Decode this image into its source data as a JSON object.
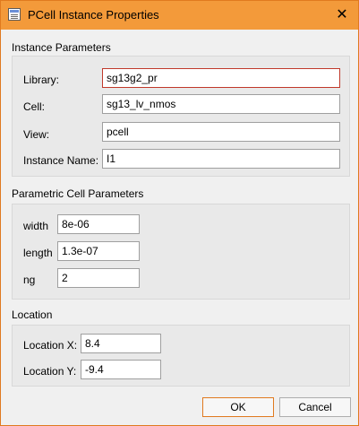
{
  "window": {
    "title": "PCell Instance Properties",
    "close_glyph": "✕"
  },
  "instance": {
    "group_title": "Instance Parameters",
    "library_label": "Library:",
    "library_value": "sg13g2_pr",
    "cell_label": "Cell:",
    "cell_value": "sg13_lv_nmos",
    "view_label": "View:",
    "view_value": "pcell",
    "name_label": "Instance Name:",
    "name_value": "I1"
  },
  "parametric": {
    "group_title": "Parametric Cell Parameters",
    "params": [
      {
        "label": "width",
        "value": "8e-06"
      },
      {
        "label": "length",
        "value": "1.3e-07"
      },
      {
        "label": "ng",
        "value": "2"
      }
    ]
  },
  "location": {
    "group_title": "Location",
    "x_label": "Location X:",
    "x_value": "8.4",
    "y_label": "Location Y:",
    "y_value": "-9.4"
  },
  "buttons": {
    "ok": "OK",
    "cancel": "Cancel"
  },
  "colors": {
    "titlebar": "#f39a3a",
    "focus_border": "#c0392b",
    "default_button_border": "#e07a1f"
  }
}
